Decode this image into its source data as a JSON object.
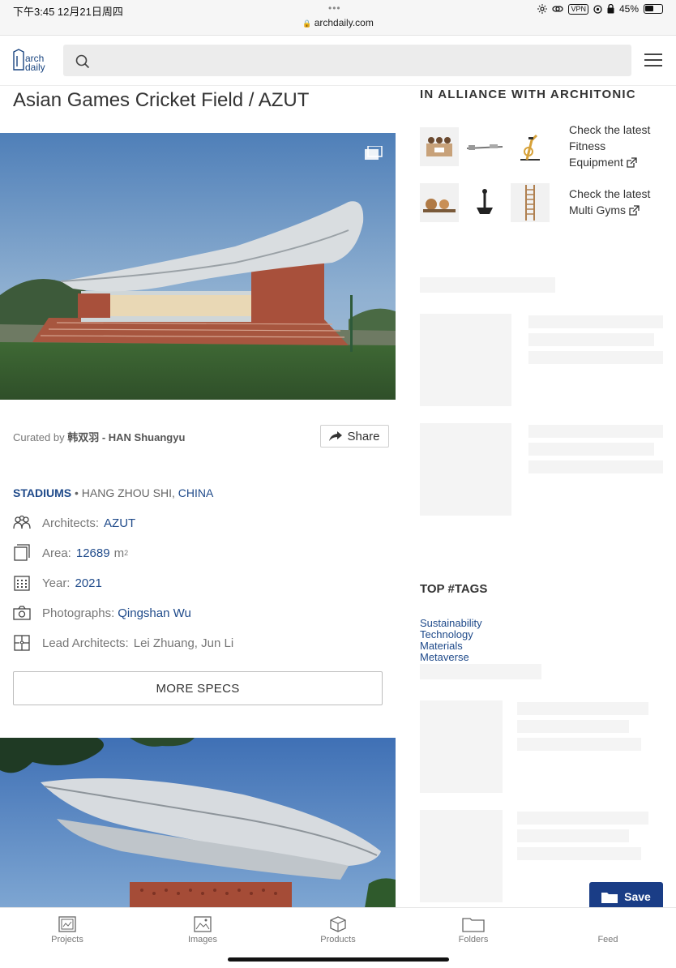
{
  "status_bar": {
    "time": "下午3:45   12月21日周四",
    "dots": "•••",
    "url": "archdaily.com",
    "vpn": "VPN",
    "battery": "45%"
  },
  "header": {
    "logo_line1": "arch",
    "logo_line2": "daily",
    "search_placeholder": ""
  },
  "article": {
    "title": "Asian Games Cricket Field / AZUT",
    "curated_prefix": "Curated by",
    "curator": "韩双羽 - HAN Shuangyu",
    "share_label": "Share",
    "category": "STADIUMS",
    "location_sep": " • ",
    "city": "HANG ZHOU SHI, ",
    "country": "CHINA",
    "specs": {
      "architects_label": "Architects:",
      "architects_value": "AZUT",
      "area_label": "Area:",
      "area_value": "12689",
      "area_unit": "m",
      "area_unit_sup": "2",
      "year_label": "Year:",
      "year_value": "2021",
      "photographs_label": "Photographs:",
      "photographs_value": "Qingshan Wu",
      "lead_label": "Lead Architects:",
      "lead_value": "Lei Zhuang, Jun Li"
    },
    "more_specs_label": "MORE SPECS"
  },
  "sidebar": {
    "alliance_title": "IN ALLIANCE WITH ARCHITONIC",
    "promo1_line1": "Check the latest",
    "promo1_line2": "Fitness",
    "promo1_line3": "Equipment",
    "promo2_line1": "Check the latest",
    "promo2_line2": "Multi Gyms",
    "top_tags_title": "TOP #TAGS",
    "tags": [
      "Sustainability",
      "Technology",
      "Materials",
      "Metaverse"
    ],
    "save_label": "Save"
  },
  "bottom_nav": {
    "projects": "Projects",
    "images": "Images",
    "products": "Products",
    "folders": "Folders",
    "feed": "Feed"
  }
}
